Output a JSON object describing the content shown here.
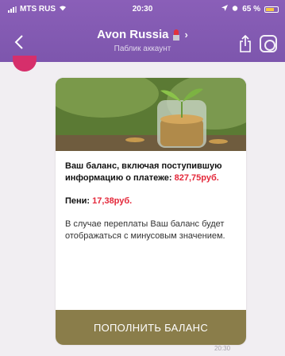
{
  "status_bar": {
    "carrier": "MTS RUS",
    "time": "20:30",
    "battery": "65 %"
  },
  "header": {
    "title": "Avon Russia",
    "subtitle": "Паблик аккаунт"
  },
  "message": {
    "balance_label": "Ваш баланс, включая поступившую информацию о платеже: ",
    "balance_value": "827,75руб.",
    "penalty_label": "Пени: ",
    "penalty_value": "17,38руб.",
    "note": "В случае переплаты Ваш баланс будет отображаться с минусовым значением.",
    "button_label": "ПОПОЛНИТЬ БАЛАНС",
    "time": "20:30"
  },
  "colors": {
    "header_bg": "#8a5fb8",
    "button_bg": "#8a7d4a",
    "accent_red": "#e4283a"
  }
}
